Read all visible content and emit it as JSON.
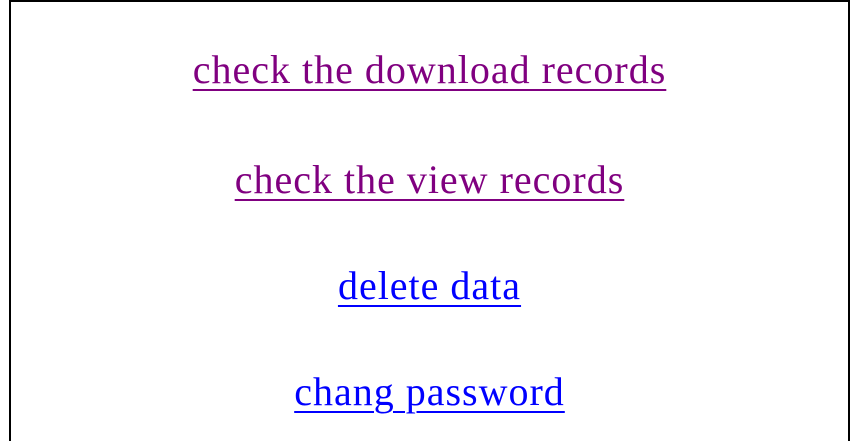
{
  "menu": {
    "items": [
      {
        "label": "check the download records",
        "state": "visited",
        "color": "#800080"
      },
      {
        "label": "check the view records",
        "state": "visited",
        "color": "#800080"
      },
      {
        "label": "delete data",
        "state": "unvisited",
        "color": "#0000ff"
      },
      {
        "label": "chang password",
        "state": "unvisited",
        "color": "#0000ff"
      }
    ]
  }
}
